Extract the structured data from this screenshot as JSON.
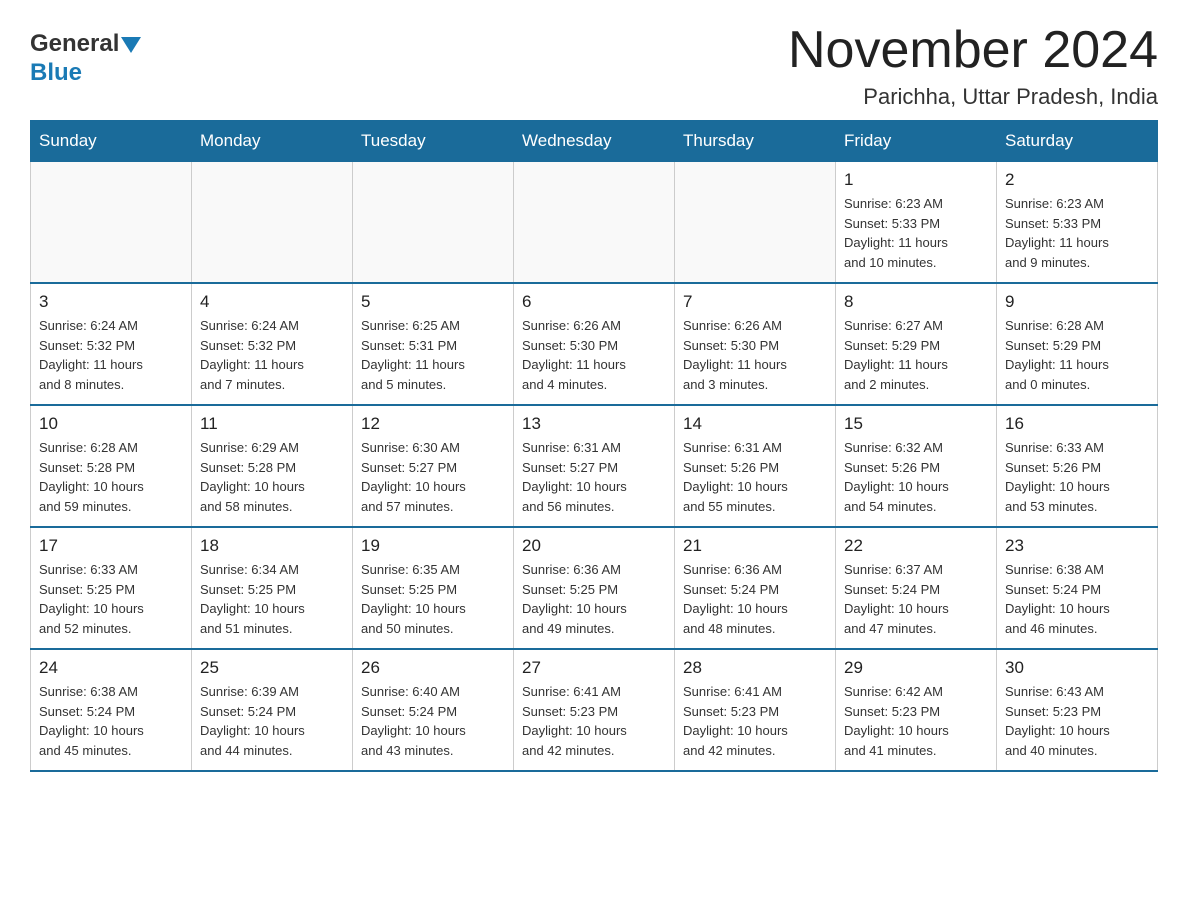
{
  "header": {
    "logo_general": "General",
    "logo_blue": "Blue",
    "month_title": "November 2024",
    "location": "Parichha, Uttar Pradesh, India"
  },
  "weekdays": [
    "Sunday",
    "Monday",
    "Tuesday",
    "Wednesday",
    "Thursday",
    "Friday",
    "Saturday"
  ],
  "weeks": [
    {
      "days": [
        {
          "number": "",
          "sunrise": "",
          "sunset": "",
          "daylight": "",
          "empty": true
        },
        {
          "number": "",
          "sunrise": "",
          "sunset": "",
          "daylight": "",
          "empty": true
        },
        {
          "number": "",
          "sunrise": "",
          "sunset": "",
          "daylight": "",
          "empty": true
        },
        {
          "number": "",
          "sunrise": "",
          "sunset": "",
          "daylight": "",
          "empty": true
        },
        {
          "number": "",
          "sunrise": "",
          "sunset": "",
          "daylight": "",
          "empty": true
        },
        {
          "number": "1",
          "info": "Sunrise: 6:23 AM\nSunset: 5:33 PM\nDaylight: 11 hours\nand 10 minutes."
        },
        {
          "number": "2",
          "info": "Sunrise: 6:23 AM\nSunset: 5:33 PM\nDaylight: 11 hours\nand 9 minutes."
        }
      ]
    },
    {
      "days": [
        {
          "number": "3",
          "info": "Sunrise: 6:24 AM\nSunset: 5:32 PM\nDaylight: 11 hours\nand 8 minutes."
        },
        {
          "number": "4",
          "info": "Sunrise: 6:24 AM\nSunset: 5:32 PM\nDaylight: 11 hours\nand 7 minutes."
        },
        {
          "number": "5",
          "info": "Sunrise: 6:25 AM\nSunset: 5:31 PM\nDaylight: 11 hours\nand 5 minutes."
        },
        {
          "number": "6",
          "info": "Sunrise: 6:26 AM\nSunset: 5:30 PM\nDaylight: 11 hours\nand 4 minutes."
        },
        {
          "number": "7",
          "info": "Sunrise: 6:26 AM\nSunset: 5:30 PM\nDaylight: 11 hours\nand 3 minutes."
        },
        {
          "number": "8",
          "info": "Sunrise: 6:27 AM\nSunset: 5:29 PM\nDaylight: 11 hours\nand 2 minutes."
        },
        {
          "number": "9",
          "info": "Sunrise: 6:28 AM\nSunset: 5:29 PM\nDaylight: 11 hours\nand 0 minutes."
        }
      ]
    },
    {
      "days": [
        {
          "number": "10",
          "info": "Sunrise: 6:28 AM\nSunset: 5:28 PM\nDaylight: 10 hours\nand 59 minutes."
        },
        {
          "number": "11",
          "info": "Sunrise: 6:29 AM\nSunset: 5:28 PM\nDaylight: 10 hours\nand 58 minutes."
        },
        {
          "number": "12",
          "info": "Sunrise: 6:30 AM\nSunset: 5:27 PM\nDaylight: 10 hours\nand 57 minutes."
        },
        {
          "number": "13",
          "info": "Sunrise: 6:31 AM\nSunset: 5:27 PM\nDaylight: 10 hours\nand 56 minutes."
        },
        {
          "number": "14",
          "info": "Sunrise: 6:31 AM\nSunset: 5:26 PM\nDaylight: 10 hours\nand 55 minutes."
        },
        {
          "number": "15",
          "info": "Sunrise: 6:32 AM\nSunset: 5:26 PM\nDaylight: 10 hours\nand 54 minutes."
        },
        {
          "number": "16",
          "info": "Sunrise: 6:33 AM\nSunset: 5:26 PM\nDaylight: 10 hours\nand 53 minutes."
        }
      ]
    },
    {
      "days": [
        {
          "number": "17",
          "info": "Sunrise: 6:33 AM\nSunset: 5:25 PM\nDaylight: 10 hours\nand 52 minutes."
        },
        {
          "number": "18",
          "info": "Sunrise: 6:34 AM\nSunset: 5:25 PM\nDaylight: 10 hours\nand 51 minutes."
        },
        {
          "number": "19",
          "info": "Sunrise: 6:35 AM\nSunset: 5:25 PM\nDaylight: 10 hours\nand 50 minutes."
        },
        {
          "number": "20",
          "info": "Sunrise: 6:36 AM\nSunset: 5:25 PM\nDaylight: 10 hours\nand 49 minutes."
        },
        {
          "number": "21",
          "info": "Sunrise: 6:36 AM\nSunset: 5:24 PM\nDaylight: 10 hours\nand 48 minutes."
        },
        {
          "number": "22",
          "info": "Sunrise: 6:37 AM\nSunset: 5:24 PM\nDaylight: 10 hours\nand 47 minutes."
        },
        {
          "number": "23",
          "info": "Sunrise: 6:38 AM\nSunset: 5:24 PM\nDaylight: 10 hours\nand 46 minutes."
        }
      ]
    },
    {
      "days": [
        {
          "number": "24",
          "info": "Sunrise: 6:38 AM\nSunset: 5:24 PM\nDaylight: 10 hours\nand 45 minutes."
        },
        {
          "number": "25",
          "info": "Sunrise: 6:39 AM\nSunset: 5:24 PM\nDaylight: 10 hours\nand 44 minutes."
        },
        {
          "number": "26",
          "info": "Sunrise: 6:40 AM\nSunset: 5:24 PM\nDaylight: 10 hours\nand 43 minutes."
        },
        {
          "number": "27",
          "info": "Sunrise: 6:41 AM\nSunset: 5:23 PM\nDaylight: 10 hours\nand 42 minutes."
        },
        {
          "number": "28",
          "info": "Sunrise: 6:41 AM\nSunset: 5:23 PM\nDaylight: 10 hours\nand 42 minutes."
        },
        {
          "number": "29",
          "info": "Sunrise: 6:42 AM\nSunset: 5:23 PM\nDaylight: 10 hours\nand 41 minutes."
        },
        {
          "number": "30",
          "info": "Sunrise: 6:43 AM\nSunset: 5:23 PM\nDaylight: 10 hours\nand 40 minutes."
        }
      ]
    }
  ]
}
